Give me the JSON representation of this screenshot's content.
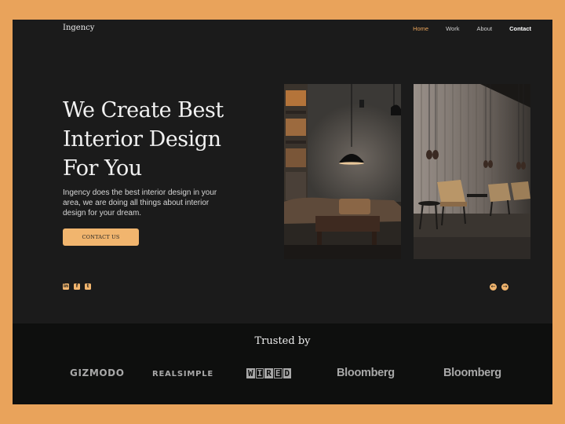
{
  "brand": {
    "logo": "Ingency"
  },
  "nav": {
    "items": [
      {
        "label": "Home",
        "active": true
      },
      {
        "label": "Work"
      },
      {
        "label": "About"
      },
      {
        "label": "Contact"
      }
    ]
  },
  "hero": {
    "title_lines": [
      "We Create Best",
      "Interior Design",
      "For You"
    ],
    "description_lines": [
      "Ingency does the best interior design in your",
      "area, we are doing  all things about interior",
      "design for your dream."
    ],
    "cta_label": "CONTACT US"
  },
  "social": [
    {
      "icon": "linkedin-icon",
      "glyph": "in"
    },
    {
      "icon": "facebook-icon",
      "glyph": "f"
    },
    {
      "icon": "twitter-icon",
      "glyph": "t"
    }
  ],
  "carousel": {
    "prev_glyph": "←",
    "next_glyph": "→"
  },
  "trusted": {
    "title": "Trusted by",
    "brands": [
      "GIZMODO",
      "REALSIMPLE",
      "WIRED",
      "Bloomberg",
      "Bloomberg"
    ]
  },
  "colors": {
    "page_bg": "#e9a35b",
    "frame_bg": "#1b1b1b",
    "trusted_bg": "#0e0f0e",
    "accent": "#f1b56e",
    "nav_active": "#e8a35a"
  }
}
